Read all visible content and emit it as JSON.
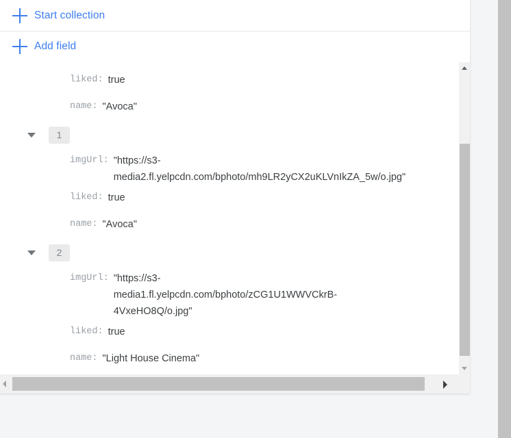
{
  "actions": [
    {
      "label": "Start collection",
      "icon": "plus-icon",
      "name": "start-collection-button"
    },
    {
      "label": "Add field",
      "icon": "plus-icon",
      "name": "add-field-button"
    }
  ],
  "document_rows": [
    {
      "type": "field",
      "key": "liked:",
      "value": "true"
    },
    {
      "type": "field",
      "key": "name:",
      "value": "\"Avoca\""
    },
    {
      "type": "index",
      "label": "1"
    },
    {
      "type": "field",
      "key": "imgUrl:",
      "value": "\"https://s3-\nmedia2.fl.yelpcdn.com/bphoto/mh9LR2yCX2uKLVnIkZA_5w/o.jpg\"",
      "wrapped": true
    },
    {
      "type": "field",
      "key": "liked:",
      "value": "true"
    },
    {
      "type": "field",
      "key": "name:",
      "value": "\"Avoca\""
    },
    {
      "type": "index",
      "label": "2"
    },
    {
      "type": "field",
      "key": "imgUrl:",
      "value": "\"https://s3-\nmedia1.fl.yelpcdn.com/bphoto/zCG1U1WWVCkrB-\n4VxeHO8Q/o.jpg\"",
      "wrapped": true
    },
    {
      "type": "field",
      "key": "liked:",
      "value": "true"
    },
    {
      "type": "field",
      "key": "name:",
      "value": "\"Light House Cinema\""
    }
  ],
  "scrollbars": {
    "vertical": {
      "up_icon": "triangle-up-icon",
      "down_icon": "triangle-down-icon"
    },
    "horizontal": {
      "left_icon": "triangle-left-icon",
      "right_icon": "triangle-right-icon"
    }
  },
  "colors": {
    "accent": "#3d7ef0",
    "key_text": "#9aa0a6",
    "value_text": "#3c4043",
    "chip_bg": "#eaeaea",
    "scroll_thumb": "#c1c1c1",
    "panel_bg": "#ffffff",
    "page_bg": "#f4f5f7"
  }
}
